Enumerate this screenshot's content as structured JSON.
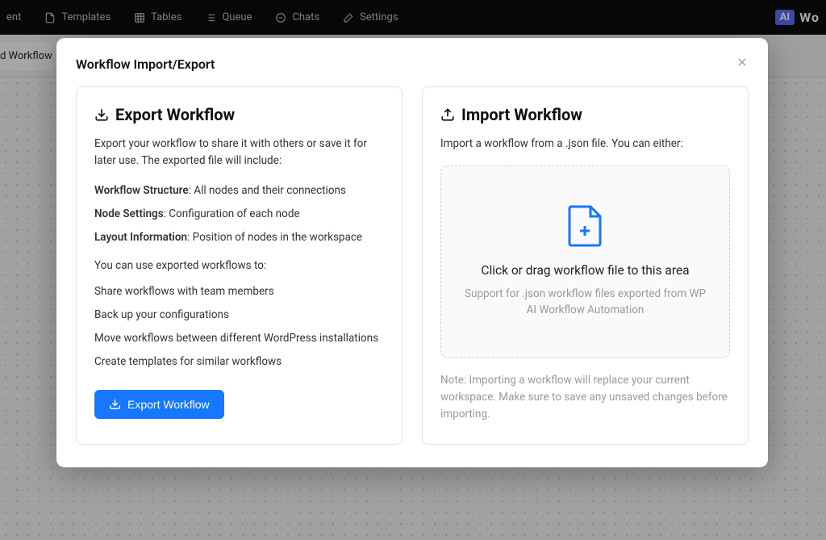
{
  "topbar": {
    "nav": [
      {
        "label": "ent",
        "icon": "box-icon"
      },
      {
        "label": "Templates",
        "icon": "file-icon"
      },
      {
        "label": "Tables",
        "icon": "grid-icon"
      },
      {
        "label": "Queue",
        "icon": "list-icon"
      },
      {
        "label": "Chats",
        "icon": "circle-icon"
      },
      {
        "label": "Settings",
        "icon": "wand-icon"
      }
    ],
    "badge": "AI",
    "brand": "Wo"
  },
  "subbar": {
    "tab": "d Workflow"
  },
  "modal": {
    "title": "Workflow Import/Export",
    "export": {
      "title": "Export Workflow",
      "desc": "Export your workflow to share it with others or save it for later use. The exported file will include:",
      "items": [
        {
          "label": "Workflow Structure",
          "value": ": All nodes and their connections"
        },
        {
          "label": "Node Settings",
          "value": ": Configuration of each node"
        },
        {
          "label": "Layout Information",
          "value": ": Position of nodes in the workspace"
        }
      ],
      "useIntro": "You can use exported workflows to:",
      "uses": [
        "Share workflows with team members",
        "Back up your configurations",
        "Move workflows between different WordPress installations",
        "Create templates for similar workflows"
      ],
      "button": "Export Workflow"
    },
    "import": {
      "title": "Import Workflow",
      "desc": "Import a workflow from a .json file. You can either:",
      "dropTitle": "Click or drag workflow file to this area",
      "dropSub": "Support for .json workflow files exported from WP AI Workflow Automation",
      "note": "Note: Importing a workflow will replace your current workspace. Make sure to save any unsaved changes before importing."
    }
  }
}
